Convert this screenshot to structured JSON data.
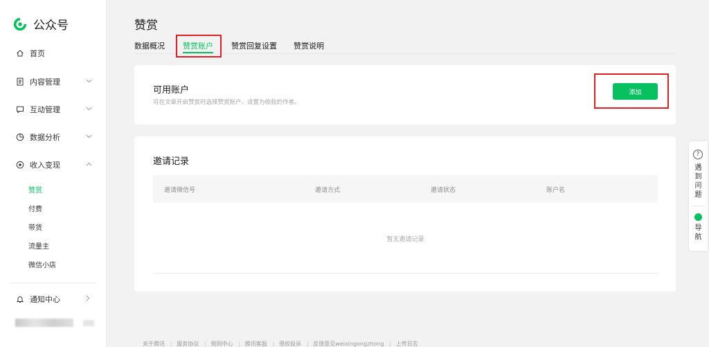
{
  "brand": {
    "name": "公众号",
    "color": "#07c160"
  },
  "sidebar": {
    "home": {
      "label": "首页",
      "icon": "home-icon"
    },
    "content": {
      "label": "内容管理",
      "icon": "document-icon"
    },
    "interaction": {
      "label": "互动管理",
      "icon": "chat-icon"
    },
    "analytics": {
      "label": "数据分析",
      "icon": "pie-icon"
    },
    "monetization": {
      "label": "收入变现",
      "icon": "target-icon"
    },
    "sub_items": [
      "赞赏",
      "付费",
      "带货",
      "流量主",
      "微信小店"
    ],
    "notifications": {
      "label": "通知中心",
      "icon": "bell-icon"
    }
  },
  "page": {
    "title": "赞赏"
  },
  "tabs": [
    "数据概况",
    "赞赏账户",
    "赞赏回复设置",
    "赞赏说明"
  ],
  "active_tab": "赞赏账户",
  "available_accounts": {
    "title": "可用账户",
    "description": "可在文章开启赞赏时选择赞赏账户，设置为收款的作者。",
    "add_button": "添加"
  },
  "invites": {
    "title": "邀请记录",
    "columns": [
      "邀请微信号",
      "邀请方式",
      "邀请状态",
      "账户名"
    ],
    "empty": "暂无邀请记录"
  },
  "float_panel": {
    "help_label": [
      "遇",
      "到",
      "问",
      "题"
    ],
    "nav_label": [
      "导",
      "航"
    ]
  },
  "footer": {
    "links": [
      "关于腾讯",
      "服务协议",
      "规则中心",
      "腾讯客服",
      "侵权投诉",
      "反馈意见weixingongzhong",
      "上传日志"
    ]
  },
  "colors": {
    "accent": "#07c160",
    "highlight_box": "#e02020"
  }
}
